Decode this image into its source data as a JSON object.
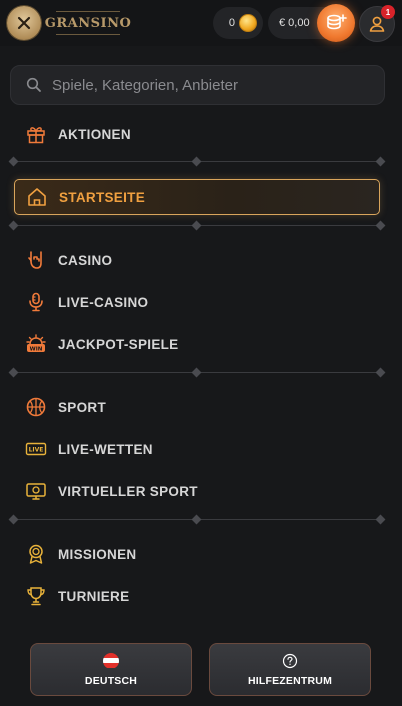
{
  "header": {
    "logo_text": "GRANSINO",
    "coins_value": "0",
    "balance_value": "€ 0,00",
    "notification_count": "1"
  },
  "search": {
    "placeholder": "Spiele, Kategorien, Anbieter"
  },
  "menu": {
    "aktionen": "AKTIONEN",
    "startseite": "STARTSEITE",
    "casino": "CASINO",
    "live_casino": "LIVE-CASINO",
    "jackpot_spiele": "JACKPOT-SPIELE",
    "sport": "SPORT",
    "live_wetten": "LIVE-WETTEN",
    "virtueller_sport": "VIRTUELLER SPORT",
    "missionen": "MISSIONEN",
    "turniere": "TURNIERE"
  },
  "icons": {
    "live_badge": "LIVE",
    "win_badge": "WIN"
  },
  "footer": {
    "language_label": "DEUTSCH",
    "help_label": "HILFEZENTRUM"
  },
  "colors": {
    "accent": "#f0a040",
    "icon_orange": "#f07a3a",
    "icon_gold": "#e8b23a",
    "background": "#17181a"
  }
}
